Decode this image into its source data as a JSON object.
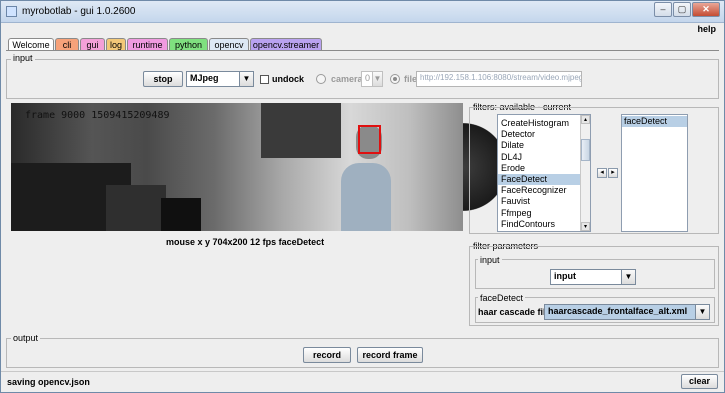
{
  "window": {
    "title": "myrobotlab - gui 1.0.2600",
    "minimize": "–",
    "maximize": "▢",
    "close": "✕"
  },
  "menu": {
    "help": "help"
  },
  "tabs": [
    {
      "label": "Welcome",
      "color": "#ffffff"
    },
    {
      "label": "cli",
      "color": "#f7a27a"
    },
    {
      "label": "gui",
      "color": "#f3a0d8"
    },
    {
      "label": "log",
      "color": "#f2c878"
    },
    {
      "label": "runtime",
      "color": "#f09ae0"
    },
    {
      "label": "python",
      "color": "#7fe07f"
    },
    {
      "label": "opencv",
      "color": "#dde8f5"
    },
    {
      "label": "opencv.streamer",
      "color": "#b9a2f0"
    }
  ],
  "input": {
    "section_label": "input",
    "stop_label": "stop",
    "grabber": "MJpeg",
    "undock_label": "undock",
    "camera_label": "camera",
    "camera_index": "0",
    "file_label": "file",
    "file_value": "http://192.158.1.106:8080/stream/video.mjpeg"
  },
  "video": {
    "overlay": "frame 9000 1509415209489",
    "status": "mouse x y 704x200  12 fps faceDetect"
  },
  "filters": {
    "section_label": "filters: available - current",
    "available": [
      "CreateHistogram",
      "Detector",
      "Dilate",
      "DL4J",
      "Erode",
      "FaceDetect",
      "FaceRecognizer",
      "Fauvist",
      "Ffmpeg",
      "FindContours"
    ],
    "selected_available": "FaceDetect",
    "current": [
      "faceDetect"
    ],
    "left_arrow": "◂",
    "right_arrow": "▸",
    "up_arrow": "▴",
    "down_arrow": "▾"
  },
  "filter_parameters": {
    "section_label": "filter parameters",
    "input_group": "input",
    "input_value": "input",
    "facedetect_group": "faceDetect",
    "cascade_label": "haar cascade file",
    "cascade_value": "haarcascade_frontalface_alt.xml"
  },
  "output": {
    "section_label": "output",
    "record_label": "record",
    "record_frame_label": "record frame"
  },
  "status": {
    "message": "saving opencv.json",
    "clear_label": "clear"
  }
}
